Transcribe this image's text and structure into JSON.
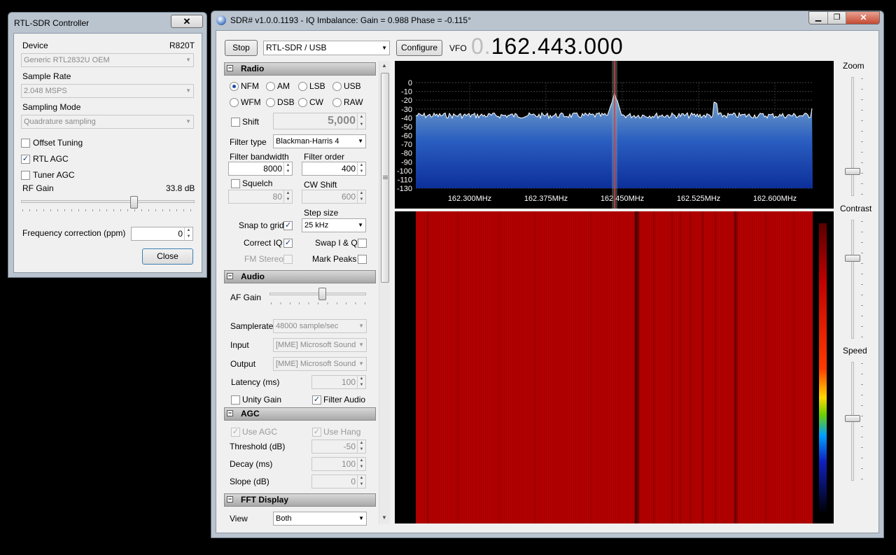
{
  "rtl": {
    "title": "RTL-SDR Controller",
    "device_label": "Device",
    "device_model": "R820T",
    "device_value": "Generic RTL2832U OEM",
    "sample_rate_label": "Sample Rate",
    "sample_rate_value": "2.048 MSPS",
    "sampling_mode_label": "Sampling Mode",
    "sampling_mode_value": "Quadrature sampling",
    "offset_tuning": "Offset Tuning",
    "rtl_agc": "RTL AGC",
    "tuner_agc": "Tuner AGC",
    "rf_gain_label": "RF Gain",
    "rf_gain_value": "33.8 dB",
    "rf_gain_level": 0.66,
    "freq_corr_label": "Frequency correction (ppm)",
    "freq_corr_value": "0",
    "close": "Close"
  },
  "main": {
    "title": "SDR# v1.0.0.1193 - IQ Imbalance: Gain = 0.988 Phase = -0.115°",
    "stop": "Stop",
    "source": "RTL-SDR / USB",
    "configure": "Configure",
    "vfo_label": "VFO",
    "vfo_dim": "0.",
    "vfo_value": "162.443.000"
  },
  "radio": {
    "header": "Radio",
    "modes": [
      "NFM",
      "AM",
      "LSB",
      "USB",
      "WFM",
      "DSB",
      "CW",
      "RAW"
    ],
    "selected_mode": "NFM",
    "shift_label": "Shift",
    "shift_value": "5,000",
    "filter_type_label": "Filter type",
    "filter_type_value": "Blackman-Harris 4",
    "filter_bw_label": "Filter bandwidth",
    "filter_bw_value": "8000",
    "filter_order_label": "Filter order",
    "filter_order_value": "400",
    "squelch_label": "Squelch",
    "squelch_value": "80",
    "cw_shift_label": "CW Shift",
    "cw_shift_value": "600",
    "step_size_label": "Step size",
    "step_size_value": "25 kHz",
    "snap_label": "Snap to grid",
    "correct_iq_label": "Correct IQ",
    "swap_iq_label": "Swap I & Q",
    "fm_stereo_label": "FM Stereo",
    "mark_peaks_label": "Mark Peaks"
  },
  "audio": {
    "header": "Audio",
    "af_gain_label": "AF Gain",
    "af_gain_level": 0.55,
    "samplerate_label": "Samplerate",
    "samplerate_value": "48000 sample/sec",
    "input_label": "Input",
    "input_value": "[MME] Microsoft Sound",
    "output_label": "Output",
    "output_value": "[MME] Microsoft Sound",
    "latency_label": "Latency (ms)",
    "latency_value": "100",
    "unity_gain_label": "Unity Gain",
    "filter_audio_label": "Filter Audio"
  },
  "agc": {
    "header": "AGC",
    "use_agc_label": "Use AGC",
    "use_hang_label": "Use Hang",
    "threshold_label": "Threshold (dB)",
    "threshold_value": "-50",
    "decay_label": "Decay (ms)",
    "decay_value": "100",
    "slope_label": "Slope (dB)",
    "slope_value": "0"
  },
  "fft": {
    "header": "FFT Display",
    "view_label": "View",
    "view_value": "Both"
  },
  "spectrum": {
    "db_labels": [
      "0",
      "-10",
      "-20",
      "-30",
      "-40",
      "-50",
      "-60",
      "-70",
      "-80",
      "-90",
      "-100",
      "-110",
      "-130"
    ],
    "freq_labels": [
      "162.300MHz",
      "162.375MHz",
      "162.450MHz",
      "162.525MHz",
      "162.600MHz"
    ]
  },
  "side": {
    "zoom_label": "Zoom",
    "contrast_label": "Contrast",
    "speed_label": "Speed"
  },
  "colors": {
    "spectrum_fill_top": "#7ea8c8",
    "spectrum_fill_bottom": "#0d2f9a",
    "waterfall": "#b30000",
    "center_line": "#d04040"
  }
}
